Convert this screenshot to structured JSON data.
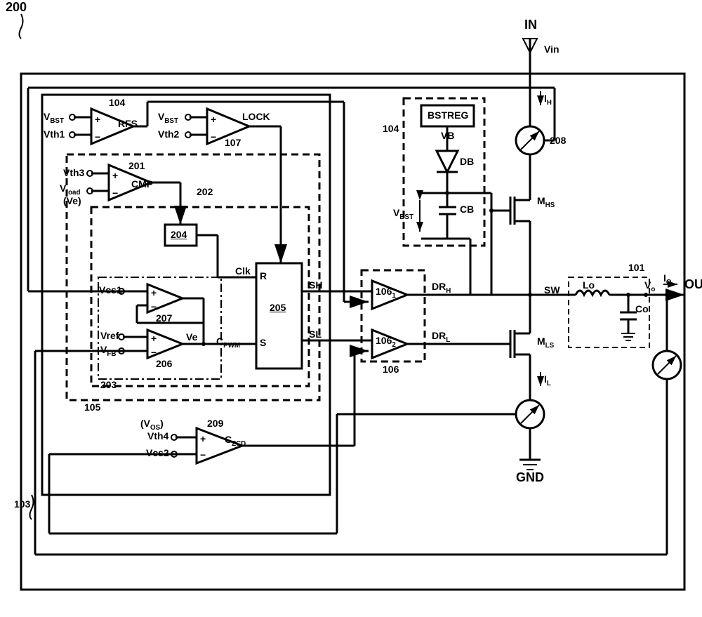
{
  "figure_ref": "200",
  "pins": {
    "in": "IN",
    "vin": "Vin",
    "out": "OUT",
    "vo": "Vo",
    "io": "Io",
    "gnd": "GND",
    "sw": "SW"
  },
  "blocks": {
    "bstreg": "BSTREG",
    "vb": "VB",
    "db": "DB",
    "cb": "CB",
    "vbst": "VBST",
    "b204": "204",
    "b205": "205"
  },
  "refs": {
    "r101": "101",
    "r103": "103",
    "r104a": "104",
    "r104b": "104",
    "r105": "105",
    "r106": "106",
    "r106_1": "106",
    "r106_2": "106",
    "r107": "107",
    "r201": "201",
    "r202": "202",
    "r203": "203",
    "r206": "206",
    "r207": "207",
    "r208": "208",
    "r209": "209"
  },
  "signals": {
    "vbst1": "VBST",
    "vth1": "Vth1",
    "vbst2": "VBST",
    "vth2": "Vth2",
    "vth3": "Vth3",
    "vload": "Vload",
    "vload_ve": "(Ve)",
    "vcs1": "Vcs1",
    "vref": "Vref",
    "vfb": "VFB",
    "ve": "Ve",
    "clk": "Clk",
    "r_in": "R",
    "s_in": "S",
    "cpwm": "CPWM",
    "sh": "SH",
    "sl": "SL",
    "drh": "DRH",
    "drl": "DRL",
    "rfs": "RFS",
    "lock": "LOCK",
    "cmp": "CMP",
    "czcd": "CZCD",
    "vos": "(VOS)",
    "vth4": "Vth4",
    "vcs2": "Vcs2",
    "mhs": "MHS",
    "mls": "MLS",
    "lo": "Lo",
    "co": "Co",
    "ih": "IH",
    "il": "IL"
  }
}
